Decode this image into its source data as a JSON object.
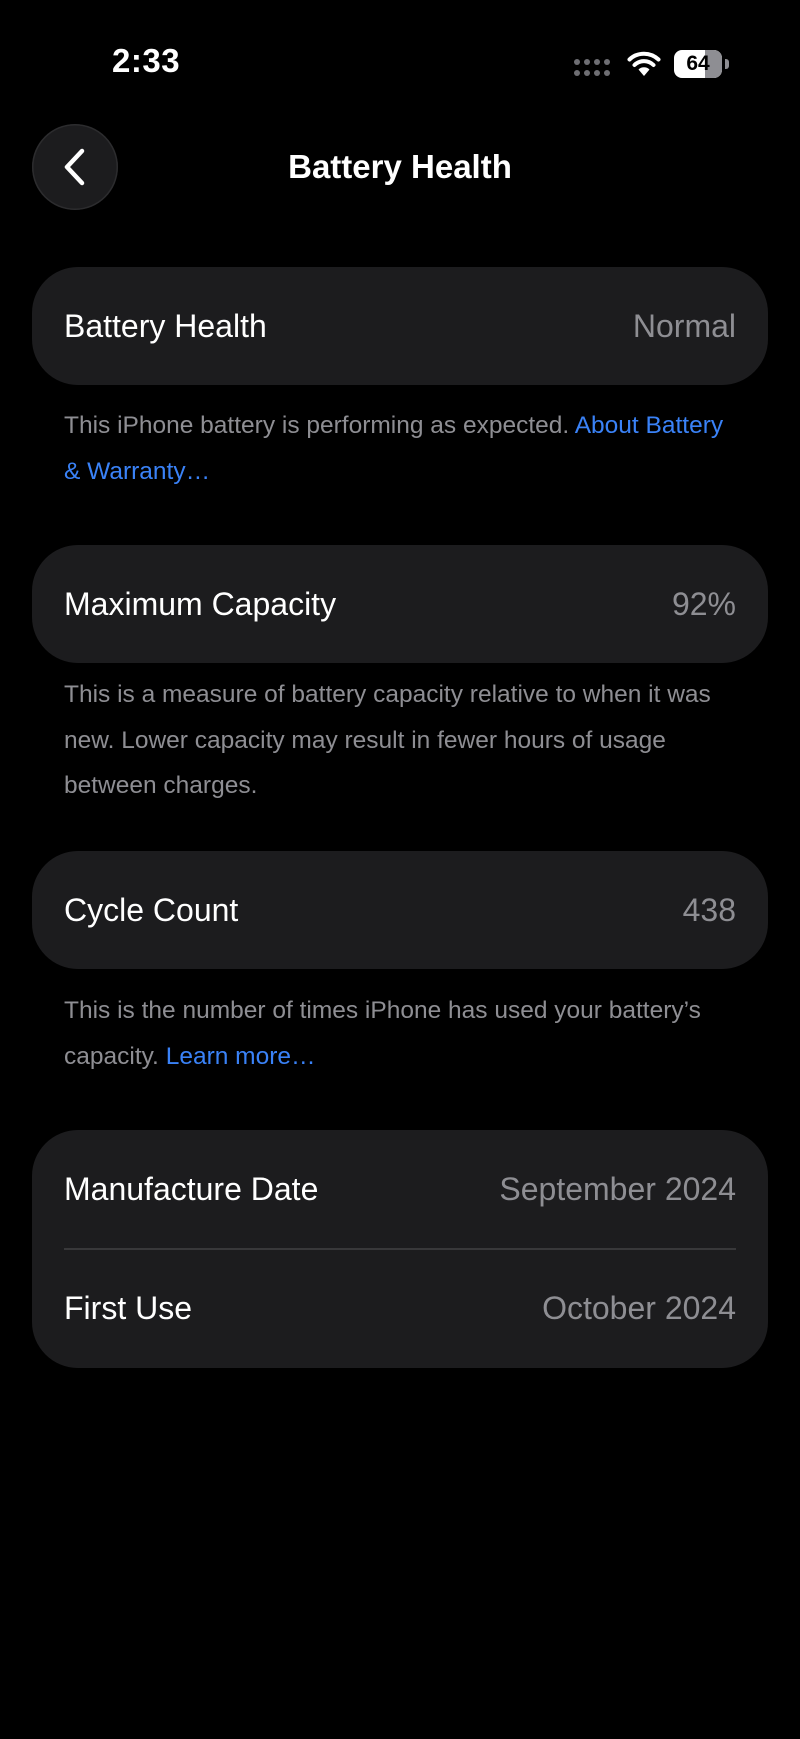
{
  "status_bar": {
    "time": "2:33",
    "battery_level": "64",
    "battery_fraction": 0.64,
    "signal_icon": "cellular-dots-icon",
    "wifi_icon": "wifi-icon"
  },
  "nav": {
    "back_icon": "chevron-left-icon",
    "title": "Battery Health"
  },
  "sections": {
    "health": {
      "label": "Battery Health",
      "value": "Normal",
      "footnote_text": "This iPhone battery is performing as expected. ",
      "footnote_link": "About Battery & Warranty…"
    },
    "capacity": {
      "label": "Maximum Capacity",
      "value": "92%",
      "footnote_text": "This is a measure of battery capacity relative to when it was new. Lower capacity may result in fewer hours of usage between charges."
    },
    "cycles": {
      "label": "Cycle Count",
      "value": "438",
      "footnote_text": "This is the number of times iPhone has used your battery’s capacity. ",
      "footnote_link": "Learn more…"
    },
    "dates": {
      "manufacture_label": "Manufacture Date",
      "manufacture_value": "September 2024",
      "first_use_label": "First Use",
      "first_use_value": "October 2024"
    }
  },
  "colors": {
    "background": "#000000",
    "card": "#1c1c1e",
    "secondary_text": "#8e8e93",
    "link": "#3a82f7"
  }
}
